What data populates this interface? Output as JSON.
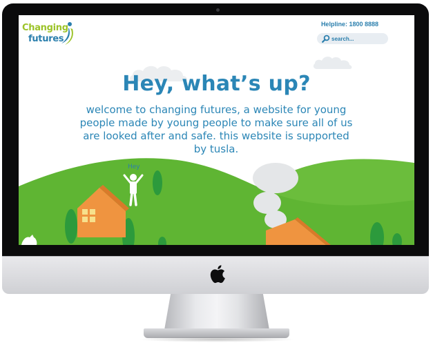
{
  "site": {
    "logo": {
      "line1": "Changing",
      "line2": "futures"
    },
    "helpline": "Helpline: 1800 8888",
    "search": {
      "placeholder": "search...",
      "value": ""
    },
    "hero": {
      "title": "Hey, what’s up?",
      "intro": "welcome to changing futures, a website for young people made by young people to make sure all of us are looked after and safe. this website is supported by tusla.",
      "figure_label": "Hey"
    }
  },
  "colors": {
    "brand_blue": "#2b86b6",
    "brand_green": "#9cc328",
    "hill_green": "#5fb533",
    "tree_green": "#2c9a3c",
    "house_orange": "#ef9440",
    "window_yellow": "#f7e08c"
  },
  "icons": [
    "search-icon",
    "apple-logo-icon",
    "logo-mark-icon"
  ]
}
